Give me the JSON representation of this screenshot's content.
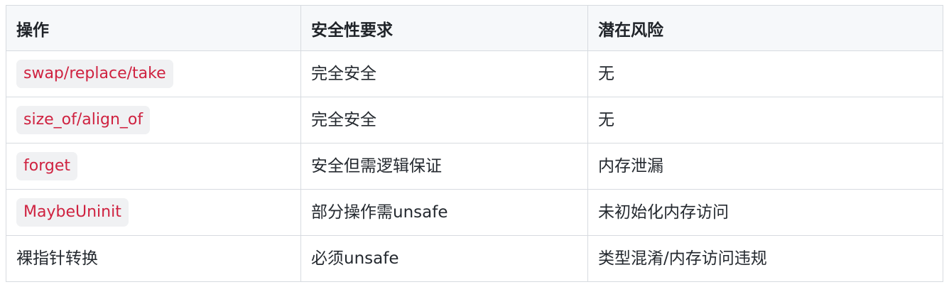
{
  "table": {
    "headers": [
      "操作",
      "安全性要求",
      "潜在风险"
    ],
    "rows": [
      {
        "operation": "swap/replace/take",
        "operation_is_code": true,
        "safety": "完全安全",
        "risk": "无"
      },
      {
        "operation": "size_of/align_of",
        "operation_is_code": true,
        "safety": "完全安全",
        "risk": "无"
      },
      {
        "operation": "forget",
        "operation_is_code": true,
        "safety": "安全但需逻辑保证",
        "risk": "内存泄漏"
      },
      {
        "operation": "MaybeUninit",
        "operation_is_code": true,
        "safety": "部分操作需unsafe",
        "risk": "未初始化内存访问"
      },
      {
        "operation": "裸指针转换",
        "operation_is_code": false,
        "safety": "必须unsafe",
        "risk": "类型混淆/内存访问违规"
      }
    ]
  },
  "colors": {
    "header_bg": "#f6f8fa",
    "border": "#d7dbe0",
    "code_text": "#cf2240",
    "code_bg": "#f0f1f3"
  }
}
